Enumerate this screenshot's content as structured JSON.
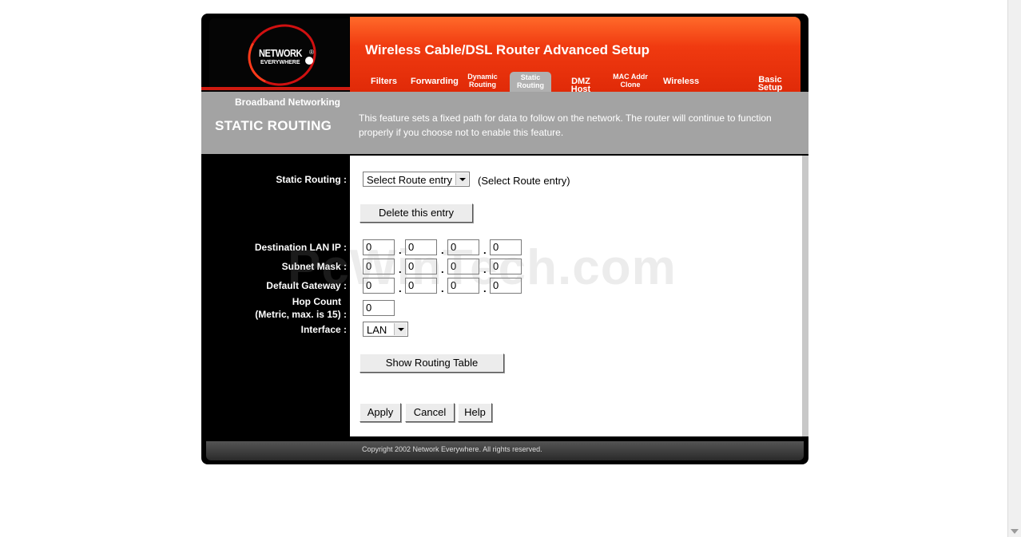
{
  "header": {
    "logo_line1": "NETWORK",
    "logo_line2": "EVERYWHERE",
    "logo_reg": "®",
    "app_title": "Wireless Cable/DSL Router Advanced Setup",
    "tabs": [
      {
        "label": "Filters"
      },
      {
        "label": "Forwarding"
      },
      {
        "label": "Dynamic Routing"
      },
      {
        "label": "Static Routing",
        "active": true
      },
      {
        "label": "DMZ Host"
      },
      {
        "label": "MAC Addr Clone"
      },
      {
        "label": "Wireless"
      },
      {
        "label": "Basic Setup"
      }
    ]
  },
  "sidebar": {
    "broadband": "Broadband Networking",
    "page_heading": "STATIC ROUTING"
  },
  "description": "This feature sets a fixed path for data to follow on the network. The router will continue to function properly if you choose not to enable this feature.",
  "form": {
    "static_routing_label": "Static Routing :",
    "route_select_value": "Select Route entry",
    "route_select_hint": "(Select Route entry)",
    "delete_button": "Delete this entry",
    "dest_lan_ip_label": "Destination LAN IP :",
    "dest_lan_ip": [
      "0",
      "0",
      "0",
      "0"
    ],
    "subnet_mask_label": "Subnet Mask :",
    "subnet_mask": [
      "0",
      "0",
      "0",
      "0"
    ],
    "default_gateway_label": "Default Gateway :",
    "default_gateway": [
      "0",
      "0",
      "0",
      "0"
    ],
    "hop_count_label": "Hop Count",
    "hop_count_sublabel": "(Metric, max. is 15) :",
    "hop_count": "0",
    "interface_label": "Interface :",
    "interface_value": "LAN",
    "show_routing_table": "Show Routing Table",
    "apply": "Apply",
    "cancel": "Cancel",
    "help": "Help",
    "ip_separator": "."
  },
  "footer": {
    "copyright": "Copyright 2002 Network Everywhere. All rights reserved."
  },
  "watermark": "PcWinTech.com",
  "colors": {
    "header_red": "#f03a10",
    "band_gray": "#a3a3a3",
    "frame_black": "#000000"
  }
}
